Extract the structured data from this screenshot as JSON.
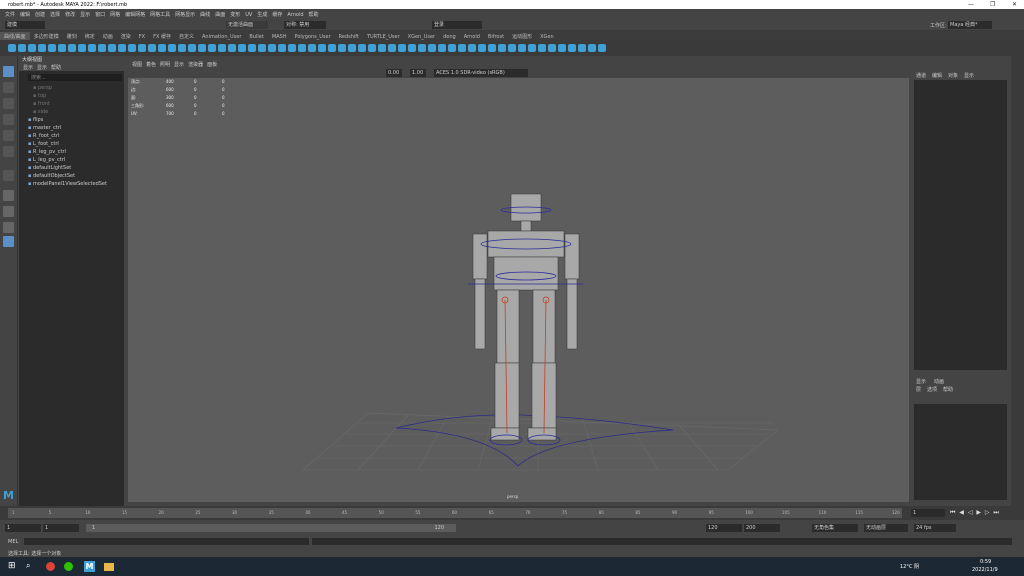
{
  "window": {
    "title": "robert.mb* - Autodesk MAYA 2022: F:\\robert.mb"
  },
  "menubar": {
    "items": [
      "文件",
      "编辑",
      "创建",
      "选择",
      "修改",
      "显示",
      "窗口",
      "网格",
      "编辑网格",
      "网格工具",
      "网格显示",
      "曲线",
      "曲面",
      "变形",
      "UV",
      "生成",
      "缓存",
      "Arnold",
      "帮助"
    ]
  },
  "statusline": {
    "mode": "建模",
    "no_live": "无激活曲面",
    "symmetry": "对称: 禁用",
    "login": "登录",
    "workspace_label": "工作区:",
    "workspace_value": "Maya 经典*"
  },
  "shelf_tabs": [
    "曲线/曲面",
    "多边形建模",
    "雕刻",
    "绑定",
    "动画",
    "渲染",
    "FX",
    "FX 缓存",
    "自定义",
    "Animation_User",
    "Bullet",
    "MASH",
    "Polygons_User",
    "Redshift",
    "TURTLE_User",
    "XGen_User",
    "deng",
    "Arnold",
    "Bifrost",
    "运动图形",
    "XGen"
  ],
  "outliner": {
    "title": "大纲视图",
    "menu": [
      "显示",
      "显示",
      "帮助"
    ],
    "search_placeholder": "搜索...",
    "items": [
      "persp",
      "top",
      "front",
      "side",
      "flips",
      "master_ctrl",
      "R_foot_ctrl",
      "L_foot_ctrl",
      "R_leg_pv_ctrl",
      "L_leg_pv_ctrl",
      "defaultLightSet",
      "defaultObjectSet",
      "modelPanel1ViewSelectedSet"
    ]
  },
  "viewport": {
    "menu": [
      "视图",
      "着色",
      "照明",
      "显示",
      "渲染器",
      "面板"
    ],
    "exposure": "0.00",
    "gamma": "1.00",
    "colorspace": "ACES 1.0 SDR-video (sRGB)",
    "camera_label": "persp",
    "hud": [
      {
        "label": "顶点:",
        "a": "400",
        "b": "0",
        "c": "0"
      },
      {
        "label": "边:",
        "a": "600",
        "b": "0",
        "c": "0"
      },
      {
        "label": "面:",
        "a": "300",
        "b": "0",
        "c": "0"
      },
      {
        "label": "三角形:",
        "a": "600",
        "b": "0",
        "c": "0"
      },
      {
        "label": "UV:",
        "a": "700",
        "b": "0",
        "c": "0"
      }
    ]
  },
  "channelbox": {
    "menu": [
      "通道",
      "编辑",
      "对象",
      "显示"
    ],
    "layer_tabs": [
      "显示",
      "动画"
    ],
    "layer_menu": [
      "层",
      "选项",
      "帮助"
    ]
  },
  "timeline": {
    "ticks": [
      "1",
      "5",
      "10",
      "15",
      "20",
      "25",
      "30",
      "35",
      "40",
      "45",
      "50",
      "55",
      "60",
      "65",
      "70",
      "75",
      "80",
      "85",
      "90",
      "95",
      "100",
      "105",
      "110",
      "115",
      "120"
    ],
    "current": "1"
  },
  "range": {
    "start": "1",
    "start_inner": "1",
    "slider_start": "1",
    "slider_end": "120",
    "end_inner": "120",
    "end": "200",
    "char_set": "无角色集",
    "anim_layer": "无动画层",
    "fps": "24 fps"
  },
  "cmdline": {
    "label": "MEL"
  },
  "helpline": {
    "text": "选择工具: 选择一个对象"
  },
  "taskbar": {
    "weather": "12°C 阴",
    "time": "0:59",
    "date": "2022/11/9"
  }
}
